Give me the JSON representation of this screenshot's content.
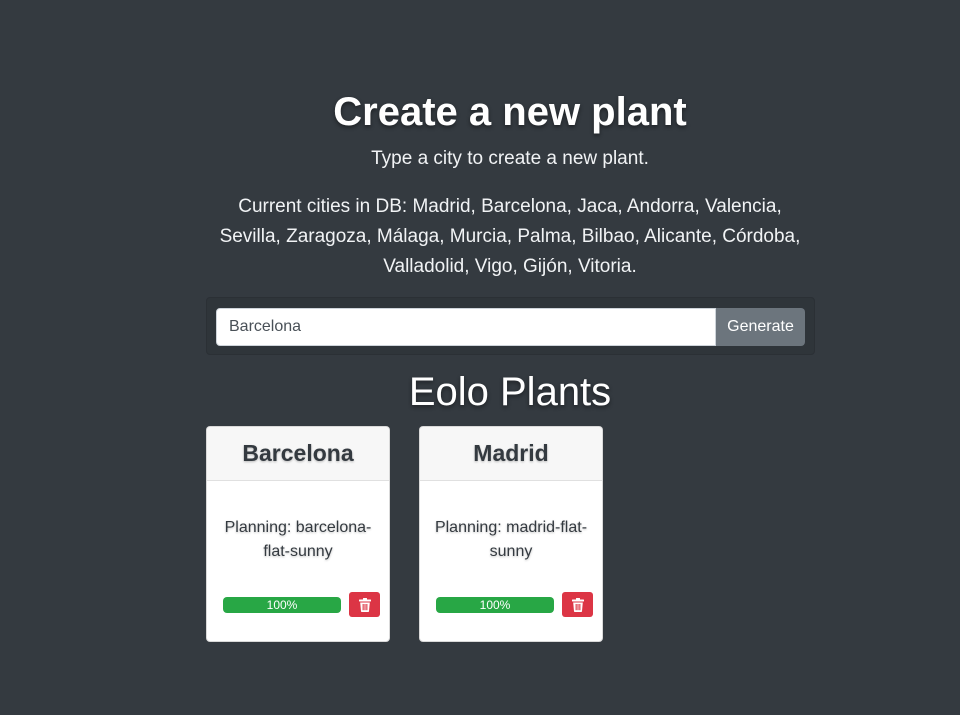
{
  "hero": {
    "title": "Create a new plant",
    "lead": "Type a city to create a new plant.",
    "cities_text": "Current cities in DB: Madrid, Barcelona, Jaca, Andorra, Valencia, Sevilla, Zaragoza, Málaga, Murcia, Palma, Bilbao, Alicante, Córdoba, Valladolid, Vigo, Gijón, Vitoria."
  },
  "form": {
    "city_value": "Barcelona",
    "generate_label": "Generate"
  },
  "plants": {
    "title": "Eolo Plants",
    "items": [
      {
        "city": "Barcelona",
        "planning": "Planning: barcelona-flat-sunny",
        "progress": 100,
        "progress_label": "100%",
        "delete_icon": "trash-icon"
      },
      {
        "city": "Madrid",
        "planning": "Planning: madrid-flat-sunny",
        "progress": 100,
        "progress_label": "100%",
        "delete_icon": "trash-icon"
      }
    ]
  },
  "colors": {
    "background": "#343a40",
    "progress": "#28a745",
    "danger": "#dc3545",
    "secondary": "#6c757d"
  }
}
